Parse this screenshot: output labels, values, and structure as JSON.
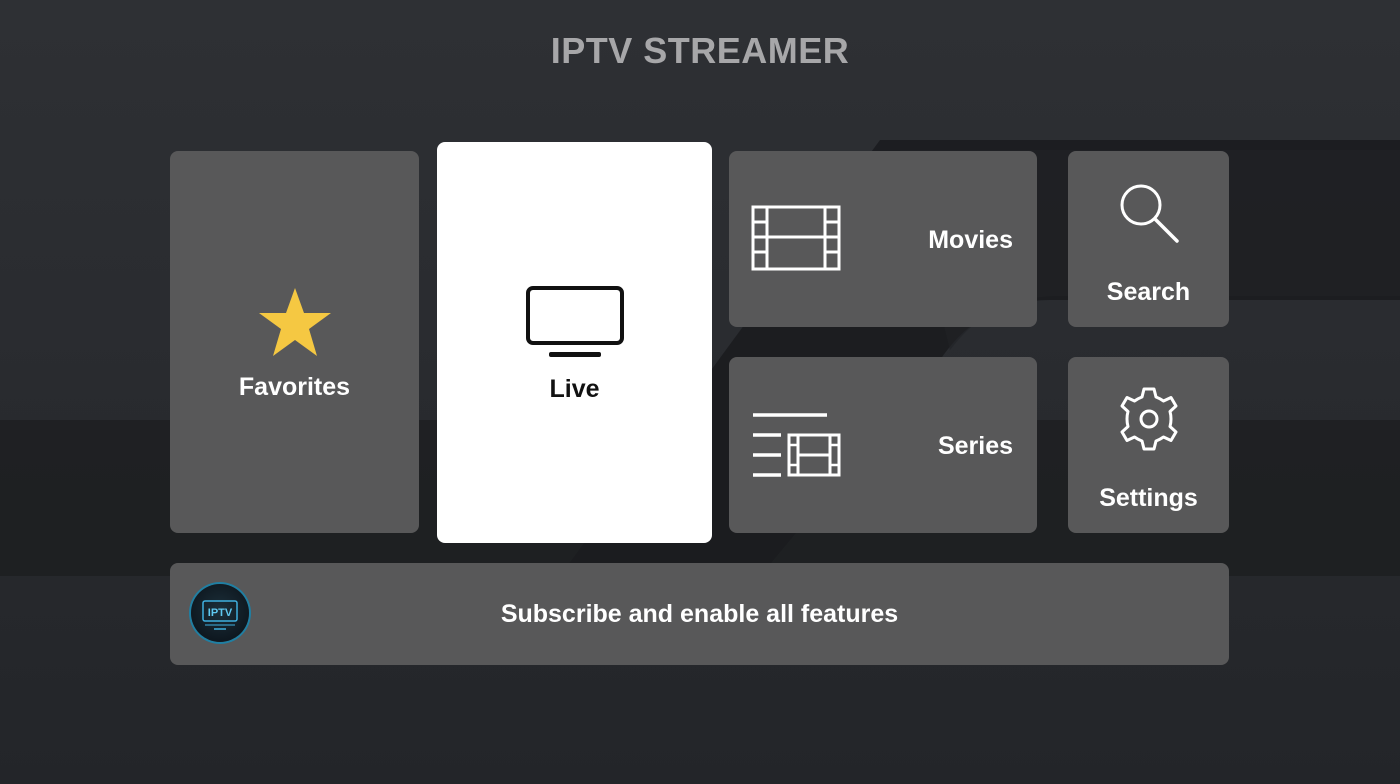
{
  "app": {
    "title": "IPTV STREAMER"
  },
  "menu": {
    "favorites": {
      "label": "Favorites",
      "icon": "star-icon",
      "icon_color": "#f5c842"
    },
    "live": {
      "label": "Live",
      "icon": "tv-icon",
      "focused": true
    },
    "movies": {
      "label": "Movies",
      "icon": "film-icon"
    },
    "series": {
      "label": "Series",
      "icon": "series-list-icon"
    },
    "search": {
      "label": "Search",
      "icon": "search-icon"
    },
    "settings": {
      "label": "Settings",
      "icon": "gear-icon"
    }
  },
  "banner": {
    "text": "Subscribe and enable all features",
    "logo": {
      "icon": "iptv-logo-icon",
      "text": "IPTV"
    }
  },
  "colors": {
    "tile": "#585859",
    "tile_focused": "#ffffff",
    "title": "#a7a7a9",
    "accent_star": "#f5c842"
  }
}
